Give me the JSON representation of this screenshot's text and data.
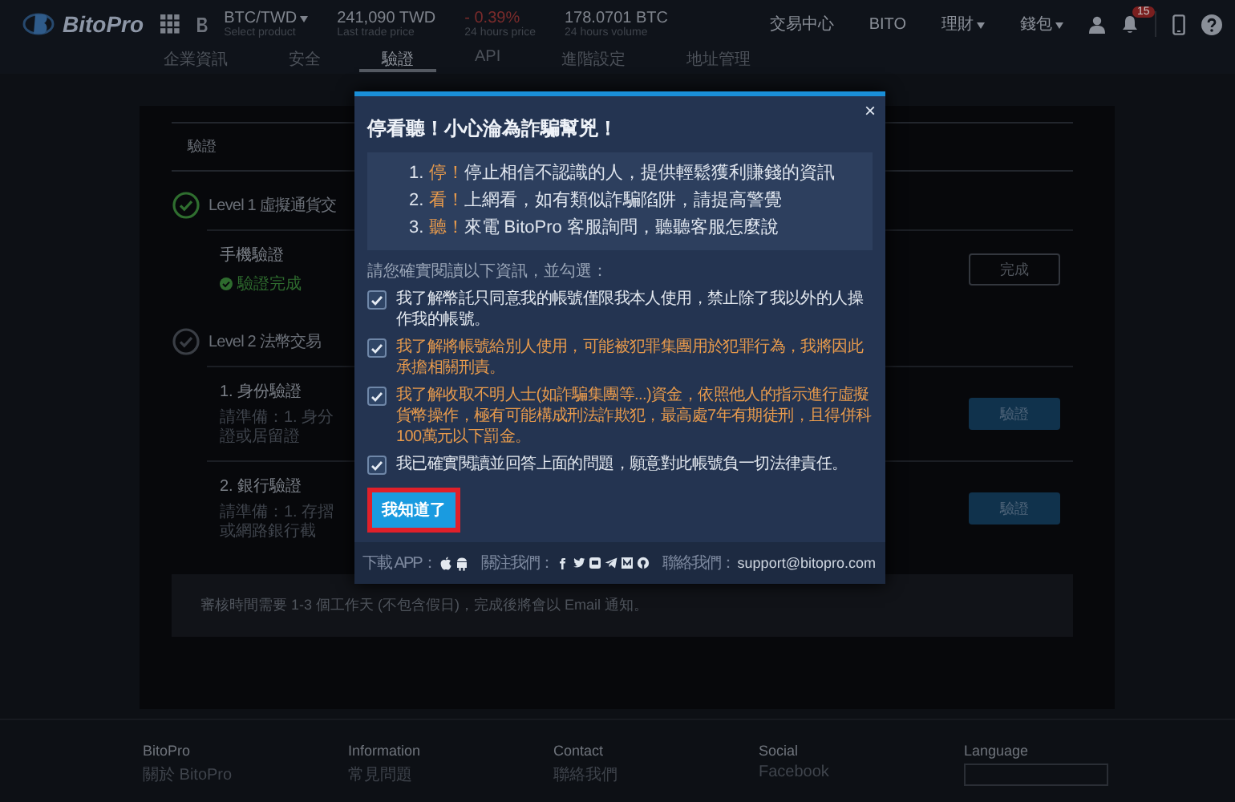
{
  "header": {
    "logo": "BitoPro",
    "pair": {
      "label": "BTC/TWD",
      "caption": "Select product"
    },
    "stats": [
      {
        "value": "241,090 TWD",
        "caption": "Last trade price",
        "kind": "neutral"
      },
      {
        "value": "- 0.39%",
        "caption": "24 hours price",
        "kind": "negative"
      },
      {
        "value": "178.0701 BTC",
        "caption": "24 hours volume",
        "kind": "neutral"
      }
    ],
    "nav": [
      {
        "label": "交易中心",
        "dropdown": false
      },
      {
        "label": "BITO",
        "dropdown": false
      },
      {
        "label": "理財",
        "dropdown": true
      },
      {
        "label": "錢包",
        "dropdown": true
      }
    ],
    "notification_count": "15"
  },
  "tabs": [
    {
      "label": "企業資訊",
      "selected": false
    },
    {
      "label": "安全",
      "selected": false
    },
    {
      "label": "驗證",
      "selected": true
    },
    {
      "label": "API",
      "selected": false
    },
    {
      "label": "進階設定",
      "selected": false
    },
    {
      "label": "地址管理",
      "selected": false
    }
  ],
  "card": {
    "title": "驗證",
    "levels": [
      {
        "title": "Level 1 虛擬通貨交",
        "done": true,
        "items": [
          {
            "title": "手機驗證",
            "status": "驗證完成",
            "button": "完成"
          }
        ]
      },
      {
        "title": "Level 2 法幣交易",
        "done": false,
        "items": [
          {
            "title": "1. 身份驗證",
            "hint": "請準備：1. 身分證或居留證",
            "button": "驗證"
          },
          {
            "title": "2. 銀行驗證",
            "hint": "請準備：1. 存摺或網路銀行截",
            "button": "驗證"
          }
        ]
      }
    ],
    "note": "審核時間需要 1-3 個工作天 (不包含假日)，完成後將會以 Email 通知。"
  },
  "footer": {
    "columns": [
      {
        "heading": "BitoPro",
        "kind": "links",
        "links": [
          "關於 BitoPro"
        ]
      },
      {
        "heading": "Information",
        "kind": "links",
        "links": [
          "常見問題"
        ]
      },
      {
        "heading": "Contact",
        "kind": "links",
        "links": [
          "聯絡我們"
        ]
      },
      {
        "heading": "Social",
        "kind": "links",
        "links": [
          "Facebook"
        ]
      },
      {
        "heading": "Language",
        "kind": "select"
      }
    ]
  },
  "modal": {
    "close": "×",
    "title": "停看聽！小心淪為詐騙幫兇！",
    "warnings": [
      {
        "number": "1.",
        "keyword": "停！",
        "text": "停止相信不認識的人，提供輕鬆獲利賺錢的資訊"
      },
      {
        "number": "2.",
        "keyword": "看！",
        "text": "上網看，如有類似詐騙陷阱，請提高警覺"
      },
      {
        "number": "3.",
        "keyword": "聽！",
        "text": "來電 BitoPro 客服詢問，聽聽客服怎麼說"
      }
    ],
    "instruction": "請您確實閱讀以下資訊，並勾選：",
    "agreements": [
      {
        "text": "我了解幣託只同意我的帳號僅限我本人使用，禁止除了我以外的人操作我的帳號。",
        "checked": true,
        "highlighted": false
      },
      {
        "text": "我了解將帳號給別人使用，可能被犯罪集團用於犯罪行為，我將因此承擔相關刑責。",
        "checked": true,
        "highlighted": true
      },
      {
        "text": "我了解收取不明人士(如詐騙集團等...)資金，依照他人的指示進行虛擬貨幣操作，極有可能構成刑法詐欺犯，最高處7年有期徒刑，且得併科100萬元以下罰金。",
        "checked": true,
        "highlighted": true
      },
      {
        "text": "我已確實閱讀並回答上面的問題，願意對此帳號負一切法律責任。",
        "checked": true,
        "highlighted": false
      }
    ],
    "confirm_button": "我知道了",
    "confirm_focused": true,
    "footer": {
      "download_label": "下載 APP：",
      "follow_label": "關注我們：",
      "contact_label": "聯絡我們：",
      "contact_email": "support@bitopro.com"
    }
  }
}
